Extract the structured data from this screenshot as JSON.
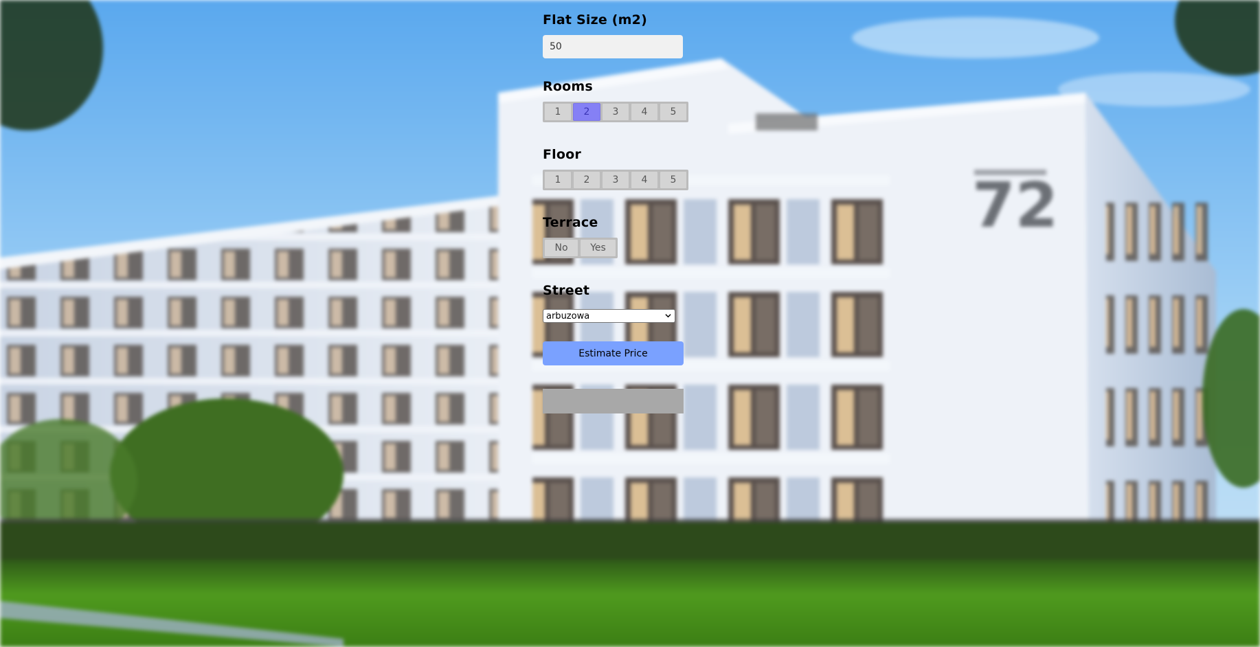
{
  "flat_size": {
    "label": "Flat Size (m2)",
    "value": "50"
  },
  "rooms": {
    "label": "Rooms",
    "options": [
      "1",
      "2",
      "3",
      "4",
      "5"
    ],
    "selected": "2"
  },
  "floor": {
    "label": "Floor",
    "options": [
      "1",
      "2",
      "3",
      "4",
      "5"
    ],
    "selected": null
  },
  "terrace": {
    "label": "Terrace",
    "options": [
      "No",
      "Yes"
    ],
    "selected": null
  },
  "street": {
    "label": "Street",
    "selected": "arbuzowa"
  },
  "estimate_button": {
    "label": "Estimate Price"
  },
  "result": {
    "text": ""
  },
  "background": {
    "building_number": "72"
  },
  "colors": {
    "accent_selected": "#8580f5",
    "button": "#7aa1ff",
    "result_box": "#a8a8a8"
  }
}
